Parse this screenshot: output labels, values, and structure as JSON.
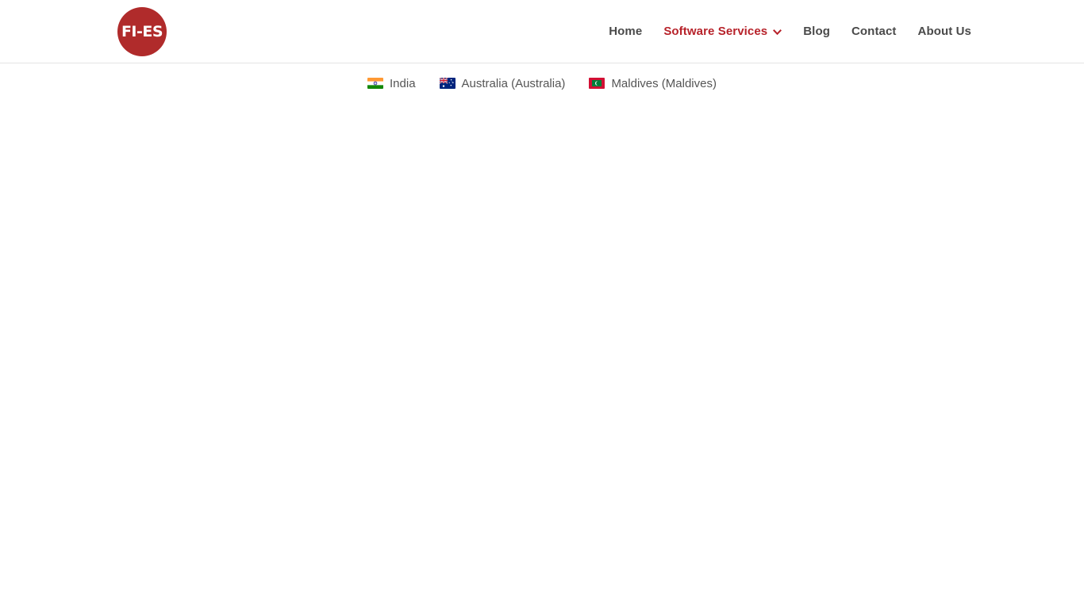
{
  "header": {
    "logo": {
      "text": "FI-ES",
      "name": "fies-logo",
      "color": "#b02b2b"
    },
    "nav": {
      "items": [
        {
          "label": "Home",
          "name": "nav-item-home",
          "active": false,
          "has_dropdown": false
        },
        {
          "label": "Software Services",
          "name": "nav-item-software-services",
          "active": true,
          "has_dropdown": true
        },
        {
          "label": "Blog",
          "name": "nav-item-blog",
          "active": false,
          "has_dropdown": false
        },
        {
          "label": "Contact",
          "name": "nav-item-contact",
          "active": false,
          "has_dropdown": false
        },
        {
          "label": "About Us",
          "name": "nav-item-about-us",
          "active": false,
          "has_dropdown": false
        }
      ],
      "active_color": "#b7222a",
      "default_color": "#4a4a4a"
    }
  },
  "countries": {
    "items": [
      {
        "label": "India",
        "flag": "flag-india-icon"
      },
      {
        "label": "Australia (Australia)",
        "flag": "flag-australia-icon"
      },
      {
        "label": "Maldives (Maldives)",
        "flag": "flag-maldives-icon"
      }
    ]
  }
}
